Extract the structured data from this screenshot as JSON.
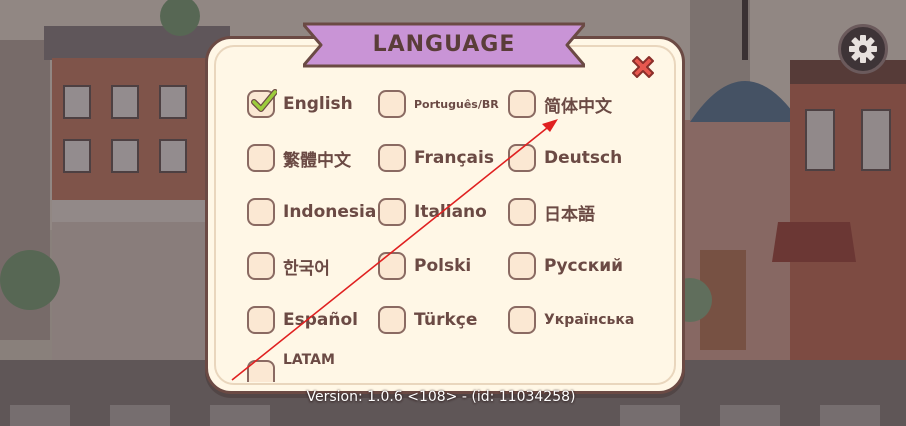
{
  "dialog": {
    "title": "LANGUAGE",
    "selected": "English",
    "languages": [
      {
        "label": "English",
        "checked": true
      },
      {
        "label": "Português/BR",
        "checked": false
      },
      {
        "label": "简体中文",
        "checked": false
      },
      {
        "label": "繁體中文",
        "checked": false
      },
      {
        "label": "Français",
        "checked": false
      },
      {
        "label": "Deutsch",
        "checked": false
      },
      {
        "label": "Indonesia",
        "checked": false
      },
      {
        "label": "Italiano",
        "checked": false
      },
      {
        "label": "日本語",
        "checked": false
      },
      {
        "label": "한국어",
        "checked": false
      },
      {
        "label": "Polski",
        "checked": false
      },
      {
        "label": "Русский",
        "checked": false
      },
      {
        "label": "Español",
        "checked": false
      },
      {
        "label": "Türkçe",
        "checked": false
      },
      {
        "label": "Українська",
        "checked": false
      },
      {
        "label": "LATAM",
        "checked": false
      }
    ]
  },
  "footer": {
    "version": "Version: 1.0.6 <108> - (id: 11034258)"
  },
  "icons": {
    "close": "close-icon",
    "settings": "gear-icon",
    "check": "checkmark-icon"
  },
  "colors": {
    "ribbon": "#c994d6",
    "check": "#9ccc3c",
    "close": "#e8584f",
    "text": "#6b4a44"
  }
}
